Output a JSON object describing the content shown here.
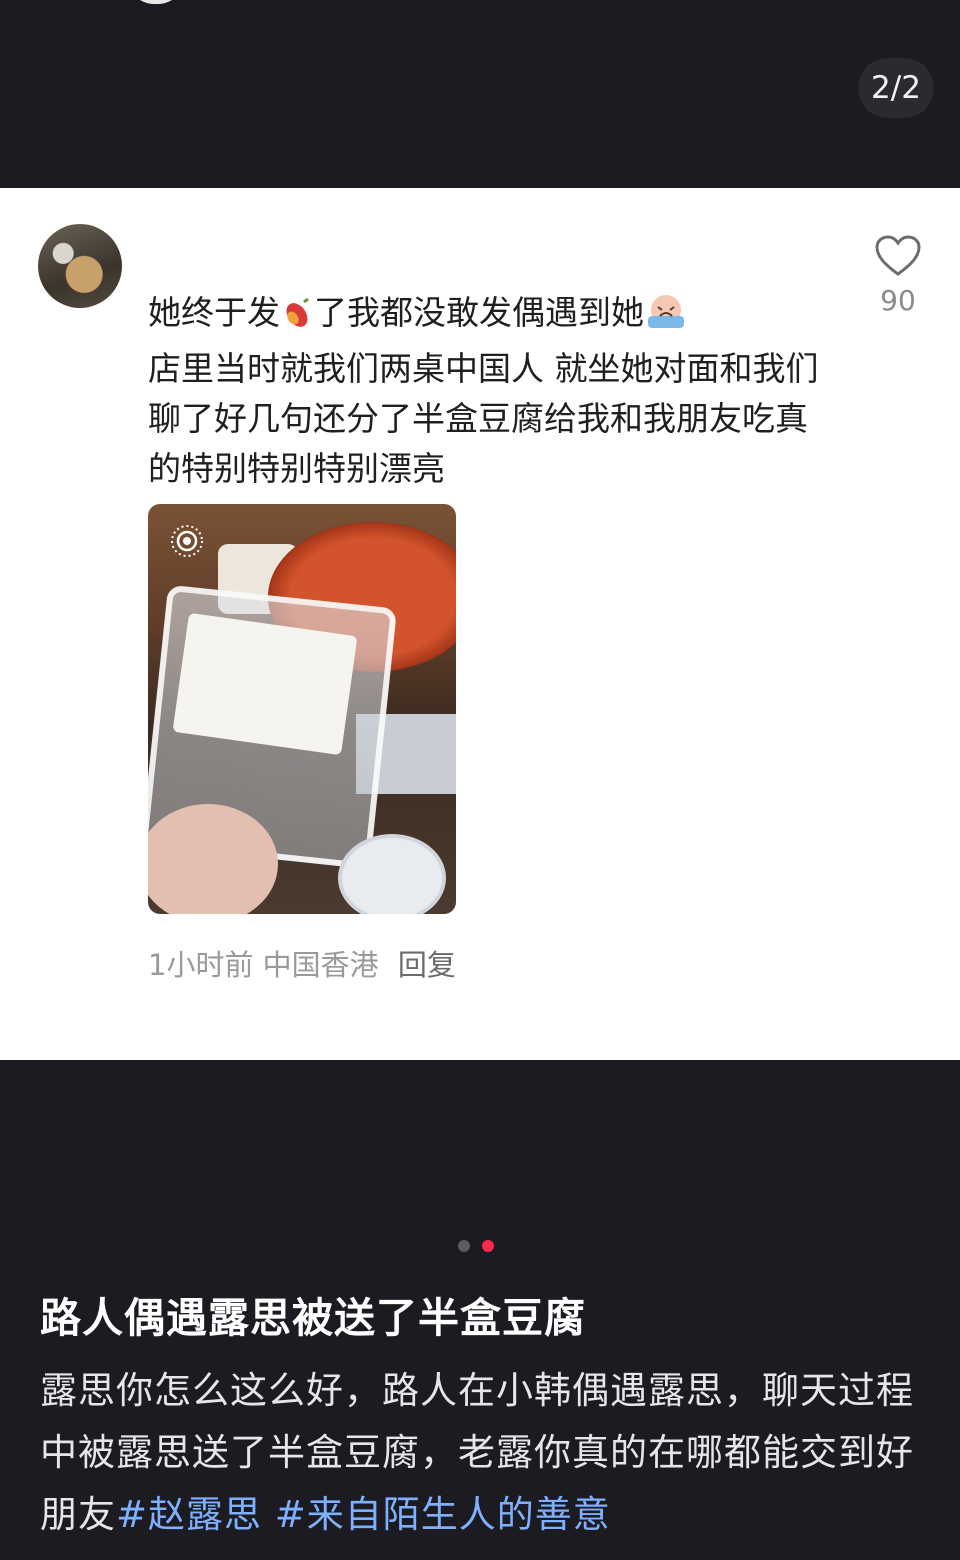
{
  "header": {
    "page_indicator": "2/2"
  },
  "comment": {
    "text_line1_part1": "她终于发",
    "text_line1_part2": "了我都没敢发偶遇到她",
    "text_rest": "店里当时就我们两桌中国人 就坐她对面和我们聊了好几句还分了半盒豆腐给我和我朋友吃真的特别特别特别漂亮",
    "like_count": "90",
    "time": "1小时前",
    "location": "中国香港",
    "reply_label": "回复",
    "icons": [
      "sweet-potato-icon",
      "crying-face-icon",
      "heart-icon",
      "live-photo-icon"
    ]
  },
  "carousel": {
    "total": 2,
    "active_index": 1,
    "accent_color": "#ff2a4a"
  },
  "post": {
    "title": "路人偶遇露思被送了半盒豆腐",
    "body": "露思你怎么这么好，路人在小韩偶遇露思，聊天过程中被露思送了半盒豆腐，老露你真的在哪都能交到好朋友",
    "tags": [
      "#赵露思 ",
      "#来自陌生人的善意"
    ],
    "tag_color": "#7fb0ff"
  }
}
